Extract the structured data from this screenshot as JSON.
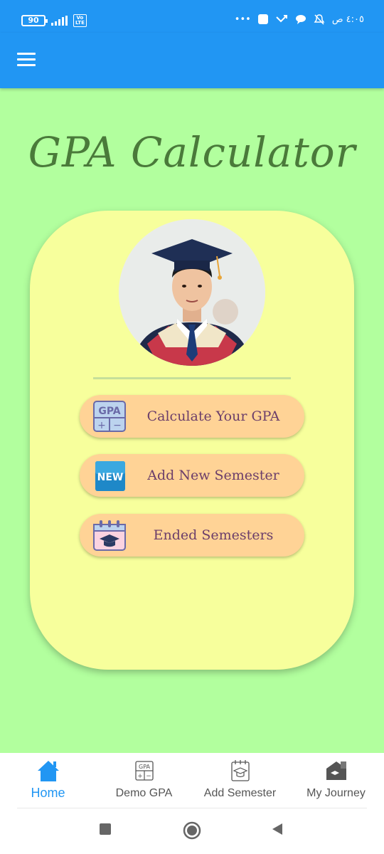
{
  "status_bar": {
    "battery": "90",
    "network": "LTE",
    "time": "٤:٠٥ ص"
  },
  "app_bar": {
    "menu_icon": "hamburger-menu-icon"
  },
  "title": "GPA Calculator",
  "buttons": [
    {
      "label": "Calculate Your GPA",
      "icon": "gpa-calculator-icon"
    },
    {
      "label": "Add New Semester",
      "icon": "new-badge-icon"
    },
    {
      "label": "Ended Semesters",
      "icon": "calendar-graduation-icon"
    }
  ],
  "bottom_nav": [
    {
      "label": "Home",
      "icon": "home-icon",
      "active": true
    },
    {
      "label": "Demo GPA",
      "icon": "gpa-icon",
      "active": false
    },
    {
      "label": "Add Semester",
      "icon": "notebook-graduation-icon",
      "active": false
    },
    {
      "label": "My Journey",
      "icon": "journey-icon",
      "active": false
    }
  ],
  "colors": {
    "app_bar": "#2196f3",
    "background": "#b2ff9e",
    "card": "#f7ff9c",
    "button": "#ffd396",
    "title": "#4a7a3a",
    "button_text": "#6b3e6a",
    "nav_active": "#2196f3"
  }
}
